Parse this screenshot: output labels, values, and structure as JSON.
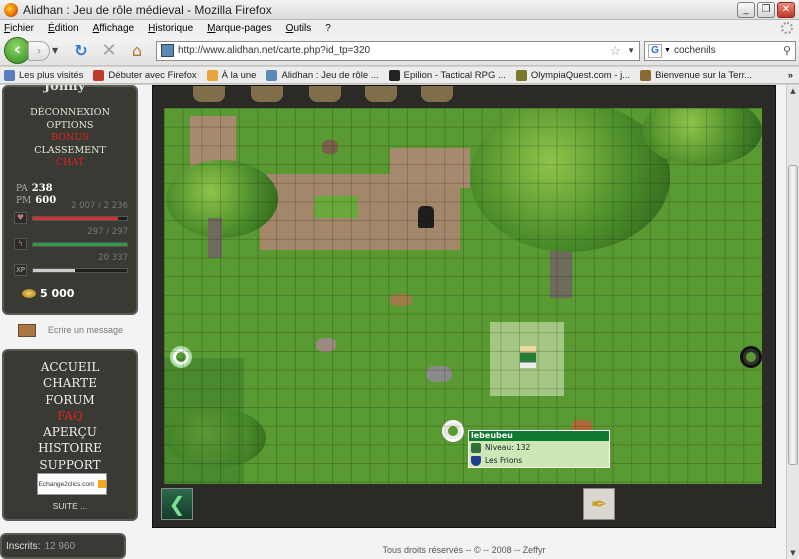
{
  "window": {
    "title": "Alidhan : Jeu de rôle médieval - Mozilla Firefox"
  },
  "menu": [
    "Fichier",
    "Édition",
    "Affichage",
    "Historique",
    "Marque-pages",
    "Outils",
    "?"
  ],
  "nav": {
    "url": "http://www.alidhan.net/carte.php?id_tp=320",
    "search_text": "cochenils"
  },
  "bookmarks": [
    {
      "label": "Les plus visités",
      "color": "#5a7fc0"
    },
    {
      "label": "Débuter avec Firefox",
      "color": "#c0392b"
    },
    {
      "label": "À la une",
      "color": "#e8a33a"
    },
    {
      "label": "Alidhan : Jeu de rôle ...",
      "color": "#5a89b8"
    },
    {
      "label": "Epilion - Tactical RPG ...",
      "color": "#222222"
    },
    {
      "label": "OlympiaQuest.com - j...",
      "color": "#7a7a2a"
    },
    {
      "label": "Bienvenue sur la Terr...",
      "color": "#8a6a30"
    }
  ],
  "player": {
    "name": "Jonny",
    "menu": [
      {
        "label": "DÉCONNEXION",
        "red": false
      },
      {
        "label": "OPTIONS",
        "red": false
      },
      {
        "label": "BONUS",
        "red": true
      },
      {
        "label": "CLASSEMENT",
        "red": false
      },
      {
        "label": "CHAT",
        "red": true
      }
    ],
    "pa_label": "PA",
    "pa": "238",
    "pm_label": "PM",
    "pm": "600",
    "hp": "2 007 / 2 236",
    "hp_ratio": 0.9,
    "energy": "297 / 297",
    "energy_ratio": 1.0,
    "xp_label": "XP",
    "xp": "20 337",
    "xp_ratio": 0.45,
    "gold": "5 000"
  },
  "write_message": "Ecrire un message",
  "main_menu": [
    {
      "label": "ACCUEIL",
      "red": false
    },
    {
      "label": "CHARTE",
      "red": false
    },
    {
      "label": "FORUM",
      "red": false
    },
    {
      "label": "FAQ",
      "red": true
    },
    {
      "label": "APERÇU",
      "red": false
    },
    {
      "label": "HISTOIRE",
      "red": false
    },
    {
      "label": "SUPPORT",
      "red": false
    }
  ],
  "banner": "Echange2clics.com",
  "suite": "SUITE ...",
  "inscrits": {
    "label": "Inscrits:",
    "value": "12 960"
  },
  "tooltip": {
    "name": "lebeubeu",
    "niveau_label": "Niveau:",
    "niveau": "132",
    "guild": "Les Frions"
  },
  "footer": "Tous droits réservés -- © -- 2008 -- Zeffyr"
}
